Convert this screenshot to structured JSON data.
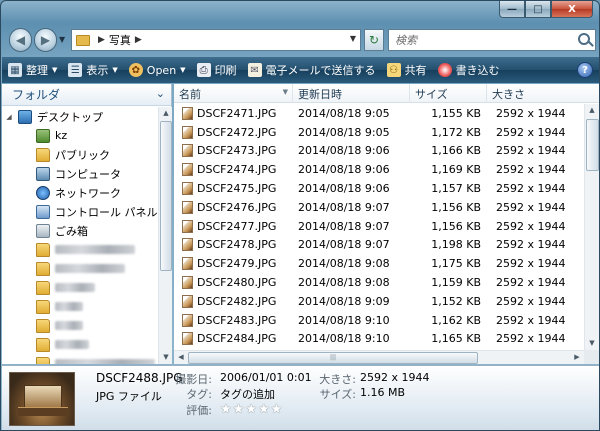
{
  "window": {
    "caption": {
      "minimize": "—",
      "maximize": "□",
      "close": "X"
    }
  },
  "address": {
    "breadcrumb": [
      "写真"
    ],
    "search_placeholder": "検索"
  },
  "toolbar": {
    "items": [
      {
        "label": "整理",
        "icon": "organize-icon",
        "dropdown": true
      },
      {
        "label": "表示",
        "icon": "views-icon",
        "dropdown": true
      },
      {
        "label": "Open",
        "icon": "open-icon",
        "dropdown": true
      },
      {
        "label": "印刷",
        "icon": "print-icon",
        "dropdown": false
      },
      {
        "label": "電子メールで送信する",
        "icon": "email-icon",
        "dropdown": false
      },
      {
        "label": "共有",
        "icon": "share-icon",
        "dropdown": false
      },
      {
        "label": "書き込む",
        "icon": "burn-icon",
        "dropdown": false
      }
    ],
    "help": "?"
  },
  "nav_pane": {
    "header": "フォルダ",
    "tree": [
      {
        "label": "デスクトップ",
        "icon": "desktop-icon",
        "level": 0
      },
      {
        "label": "kz",
        "icon": "user-folder-icon",
        "level": 1
      },
      {
        "label": "パブリック",
        "icon": "folder-icon",
        "level": 1
      },
      {
        "label": "コンピュータ",
        "icon": "computer-icon",
        "level": 1
      },
      {
        "label": "ネットワーク",
        "icon": "network-icon",
        "level": 1
      },
      {
        "label": "コントロール パネル",
        "icon": "control-panel-icon",
        "level": 1
      },
      {
        "label": "ごみ箱",
        "icon": "recycle-bin-icon",
        "level": 1
      },
      {
        "label": "",
        "icon": "folder-icon",
        "level": 1,
        "blurred": 80
      },
      {
        "label": "",
        "icon": "folder-icon",
        "level": 1,
        "blurred": 70
      },
      {
        "label": "",
        "icon": "folder-icon",
        "level": 1,
        "blurred": 40
      },
      {
        "label": "",
        "icon": "folder-icon",
        "level": 1,
        "blurred": 28
      },
      {
        "label": "",
        "icon": "folder-icon",
        "level": 1,
        "blurred": 28
      },
      {
        "label": "",
        "icon": "folder-icon",
        "level": 1,
        "blurred": 34
      },
      {
        "label": "",
        "icon": "folder-icon",
        "level": 1,
        "blurred": 100
      }
    ]
  },
  "file_list": {
    "columns": [
      "名前",
      "更新日時",
      "サイズ",
      "大きさ"
    ],
    "rows": [
      [
        "DSCF2471.JPG",
        "2014/08/18 9:05",
        "1,155 KB",
        "2592 x 1944"
      ],
      [
        "DSCF2472.JPG",
        "2014/08/18 9:05",
        "1,172 KB",
        "2592 x 1944"
      ],
      [
        "DSCF2473.JPG",
        "2014/08/18 9:06",
        "1,166 KB",
        "2592 x 1944"
      ],
      [
        "DSCF2474.JPG",
        "2014/08/18 9:06",
        "1,169 KB",
        "2592 x 1944"
      ],
      [
        "DSCF2475.JPG",
        "2014/08/18 9:06",
        "1,157 KB",
        "2592 x 1944"
      ],
      [
        "DSCF2476.JPG",
        "2014/08/18 9:07",
        "1,156 KB",
        "2592 x 1944"
      ],
      [
        "DSCF2477.JPG",
        "2014/08/18 9:07",
        "1,156 KB",
        "2592 x 1944"
      ],
      [
        "DSCF2478.JPG",
        "2014/08/18 9:07",
        "1,198 KB",
        "2592 x 1944"
      ],
      [
        "DSCF2479.JPG",
        "2014/08/18 9:08",
        "1,175 KB",
        "2592 x 1944"
      ],
      [
        "DSCF2480.JPG",
        "2014/08/18 9:08",
        "1,159 KB",
        "2592 x 1944"
      ],
      [
        "DSCF2482.JPG",
        "2014/08/18 9:09",
        "1,152 KB",
        "2592 x 1944"
      ],
      [
        "DSCF2483.JPG",
        "2014/08/18 9:10",
        "1,162 KB",
        "2592 x 1944"
      ],
      [
        "DSCF2484.JPG",
        "2014/08/18 9:10",
        "1,165 KB",
        "2592 x 1944"
      ]
    ]
  },
  "details": {
    "file_name": "DSCF2488.JPG",
    "file_type": "JPG ファイル",
    "taken_label": "撮影日:",
    "taken_value": "2006/01/01 0:01",
    "tags_label": "タグ:",
    "tags_value": "タグの追加",
    "rating_label": "評価:",
    "rating_stars": 0,
    "rating_max": 5,
    "dimensions_label": "大きさ:",
    "dimensions_value": "2592 x 1944",
    "size_label": "サイズ:",
    "size_value": "1.16 MB"
  }
}
